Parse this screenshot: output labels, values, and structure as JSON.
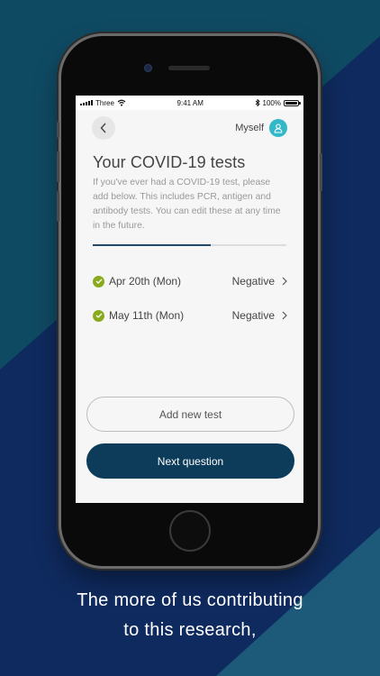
{
  "status_bar": {
    "carrier": "Three",
    "time": "9:41 AM",
    "battery": "100%"
  },
  "header": {
    "back_icon": "chevron-left-icon",
    "profile_label": "Myself",
    "profile_icon": "person-icon"
  },
  "page": {
    "title": "Your COVID-19 tests",
    "description": "If you've ever had a COVID-19 test,  please add below. This includes PCR, antigen and antibody tests. You can edit these at any time in the future.",
    "progress": 0.61
  },
  "tests": [
    {
      "date": "Apr 20th (Mon)",
      "result": "Negative"
    },
    {
      "date": "May 11th (Mon)",
      "result": "Negative"
    }
  ],
  "buttons": {
    "add_test": "Add new test",
    "next_question": "Next question"
  },
  "caption": {
    "line1": "The more of us contributing",
    "line2": "to this research,"
  },
  "colors": {
    "background_dark": "#0f2a5e",
    "background_teal": "#0f4a63",
    "primary_button": "#0d3b5a",
    "check_green": "#8aaa1e",
    "avatar_teal": "#33b8c9",
    "progress_fill": "#1f4a6b"
  }
}
